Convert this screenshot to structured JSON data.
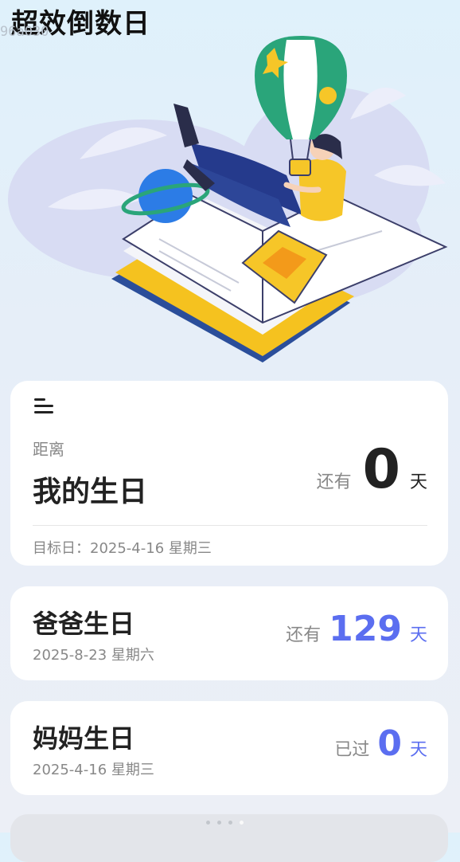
{
  "app": {
    "title": "超效倒数日",
    "ghost_text": "96a030"
  },
  "main_event": {
    "distance_label": "距离",
    "title": "我的生日",
    "remain_label": "还有",
    "days": "0",
    "unit": "天",
    "target_date_text": "目标日：2025-4-16 星期三"
  },
  "events": [
    {
      "title": "爸爸生日",
      "date": "2025-8-23 星期六",
      "label": "还有",
      "days": "129",
      "unit": "天"
    },
    {
      "title": "妈妈生日",
      "date": "2025-4-16 星期三",
      "label": "已过",
      "days": "0",
      "unit": "天"
    }
  ],
  "colors": {
    "accent": "#5b6ef0",
    "balloon_green": "#2aa57a",
    "yellow": "#f6c628",
    "navy": "#253a8c",
    "planet_blue": "#2c7ce6"
  },
  "icons": [
    "menu-icon",
    "hot-air-balloon-illustration",
    "open-book-illustration",
    "planet-illustration"
  ],
  "pager": {
    "count": 4,
    "active_index": 3
  }
}
